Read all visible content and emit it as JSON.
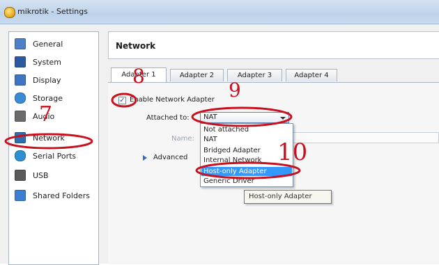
{
  "window": {
    "title": "mikrotik - Settings"
  },
  "sidebar": {
    "items": [
      {
        "label": "General",
        "icon": "general-icon",
        "color": "#4f7fc4"
      },
      {
        "label": "System",
        "icon": "system-icon",
        "color": "#2c5aa0"
      },
      {
        "label": "Display",
        "icon": "display-icon",
        "color": "#3f73c4"
      },
      {
        "label": "Storage",
        "icon": "storage-icon",
        "color": "#3a8ad6"
      },
      {
        "label": "Audio",
        "icon": "audio-icon",
        "color": "#6b6b6b"
      },
      {
        "label": "Network",
        "icon": "network-icon",
        "color": "#2f6fb0"
      },
      {
        "label": "Serial Ports",
        "icon": "serial-ports-icon",
        "color": "#2f8fd4"
      },
      {
        "label": "USB",
        "icon": "usb-icon",
        "color": "#5a5a5a"
      },
      {
        "label": "Shared Folders",
        "icon": "shared-folders-icon",
        "color": "#3c7fd0"
      }
    ],
    "selected": "Network"
  },
  "section": {
    "title": "Network"
  },
  "tabs": [
    {
      "label": "Adapter 1",
      "active": true
    },
    {
      "label": "Adapter 2",
      "active": false
    },
    {
      "label": "Adapter 3",
      "active": false
    },
    {
      "label": "Adapter 4",
      "active": false
    }
  ],
  "adapter": {
    "enable_label": "Enable Network Adapter",
    "enabled": true,
    "attached_label": "Attached to:",
    "attached_value": "NAT",
    "name_label": "Name:",
    "advanced_label": "Advanced"
  },
  "dropdown": {
    "options": [
      "Not attached",
      "NAT",
      "Bridged Adapter",
      "Internal Network",
      "Host-only Adapter",
      "Generic Driver"
    ],
    "highlighted": "Host-only Adapter"
  },
  "tooltip": {
    "text": "Host-only Adapter"
  },
  "annotations": {
    "color": "#c8101e",
    "numbers": [
      "7",
      "8",
      "9",
      "10"
    ]
  }
}
